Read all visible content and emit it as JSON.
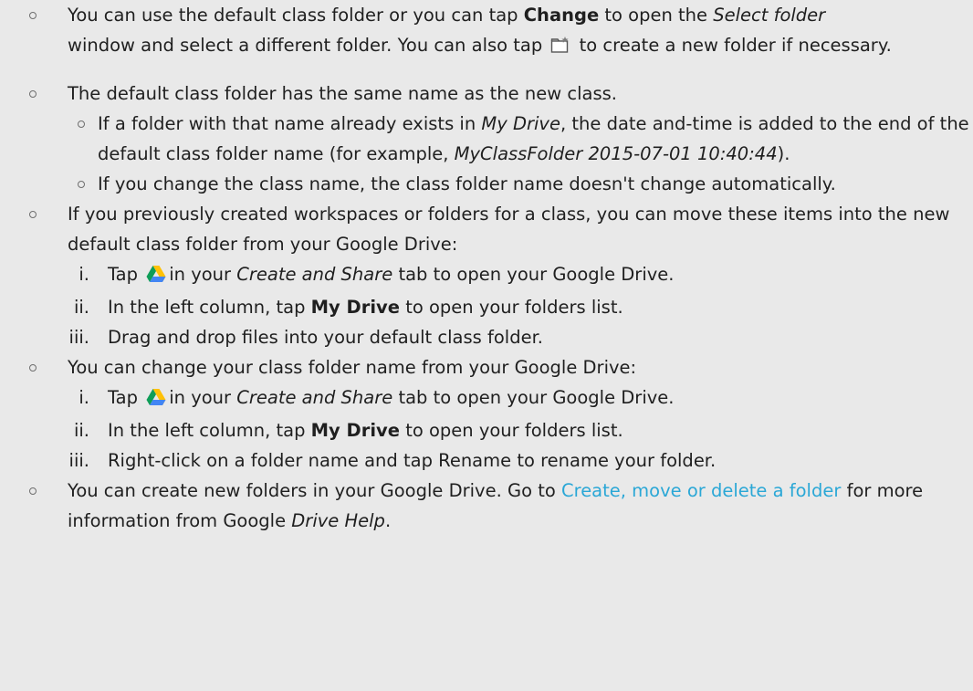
{
  "b1": {
    "t1": "You can use the default class folder or you can tap ",
    "change": "Change",
    "t2": " to open the ",
    "select_folder": "Select folder",
    "t3": " window and select a different folder. You can also tap ",
    "t4": " to create a new folder if necessary."
  },
  "b2": {
    "text": "The default class folder has the same name as the new class.",
    "s1": {
      "t1": "If a folder with that name already exists in ",
      "my_drive": "My Drive",
      "t2": ", the date and-time is added to the end of the default class folder name (for example, ",
      "example": "MyClassFolder 2015-07-01 10:40:44",
      "t3": ")."
    },
    "s2": "If you change the class name, the class folder name doesn't change automatically."
  },
  "b3": {
    "text": "If you previously created workspaces or folders for a class, you can move these items into the new default class folder from your Google Drive:",
    "steps": [
      {
        "num": "i.",
        "a": "Tap ",
        "tab": "Create and Share",
        "b": " tab to open your Google Drive.",
        "pre": "in your "
      },
      {
        "num": "ii.",
        "a": "In the left column, tap ",
        "bold": "My Drive",
        "b": " to open your folders list."
      },
      {
        "num": "iii.",
        "a": "Drag and drop files into your default class folder."
      }
    ]
  },
  "b4": {
    "text": "You can change your class folder name from your Google Drive:",
    "steps": [
      {
        "num": "i.",
        "a": "Tap ",
        "pre": "in your ",
        "tab": "Create and Share",
        "b": " tab to open your Google Drive."
      },
      {
        "num": "ii.",
        "a": "In the left column, tap ",
        "bold": "My Drive",
        "b": " to open your folders list."
      },
      {
        "num": "iii.",
        "a": "Right-click on a folder name and tap Rename to rename your folder."
      }
    ]
  },
  "b5": {
    "t1": "You can create new folders in your Google Drive. Go to ",
    "link": "Create, move or delete a folder",
    "t2": " for more information from Google ",
    "drive_help": "Drive Help",
    "t3": "."
  },
  "colors": {
    "link": "#2aa7d6",
    "text": "#1f1f1f",
    "background": "#e9e9e9"
  },
  "icons": {
    "new_folder": "new-folder-icon",
    "google_drive": "google-drive-icon"
  }
}
